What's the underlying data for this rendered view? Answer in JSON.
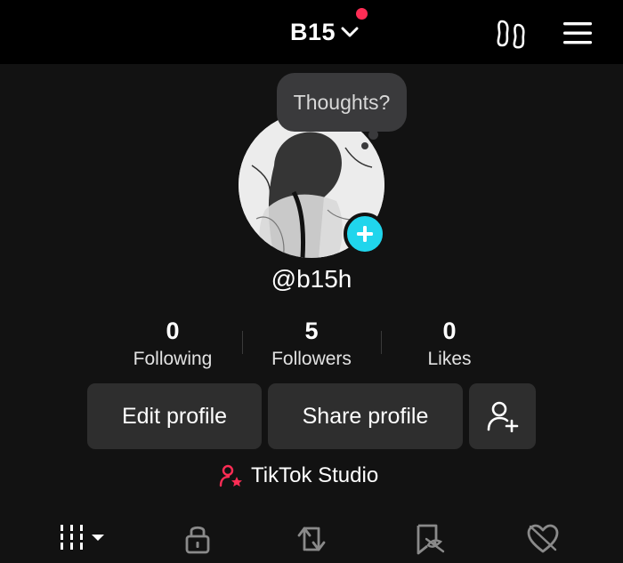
{
  "topbar": {
    "account_name": "B15",
    "colors": {
      "notification_dot": "#ff2d55",
      "background": "#000000"
    },
    "icons": [
      "chevron-down-icon",
      "footprint-icon",
      "menu-icon"
    ]
  },
  "profile": {
    "thought_bubble": "Thoughts?",
    "username": "@b15h",
    "add_button_color": "#20d5ec"
  },
  "stats": [
    {
      "value": "0",
      "label": "Following"
    },
    {
      "value": "5",
      "label": "Followers"
    },
    {
      "value": "0",
      "label": "Likes"
    }
  ],
  "actions": {
    "edit_profile": "Edit profile",
    "share_profile": "Share profile",
    "add_friend_icon": "add-friend-icon"
  },
  "studio": {
    "label": "TikTok Studio",
    "icon_color": "#ff2d55"
  },
  "tabs": [
    {
      "icon": "grid-icon",
      "active": true
    },
    {
      "icon": "lock-icon",
      "active": false
    },
    {
      "icon": "repost-icon",
      "active": false
    },
    {
      "icon": "favorites-icon",
      "active": false
    },
    {
      "icon": "liked-icon",
      "active": false
    }
  ]
}
